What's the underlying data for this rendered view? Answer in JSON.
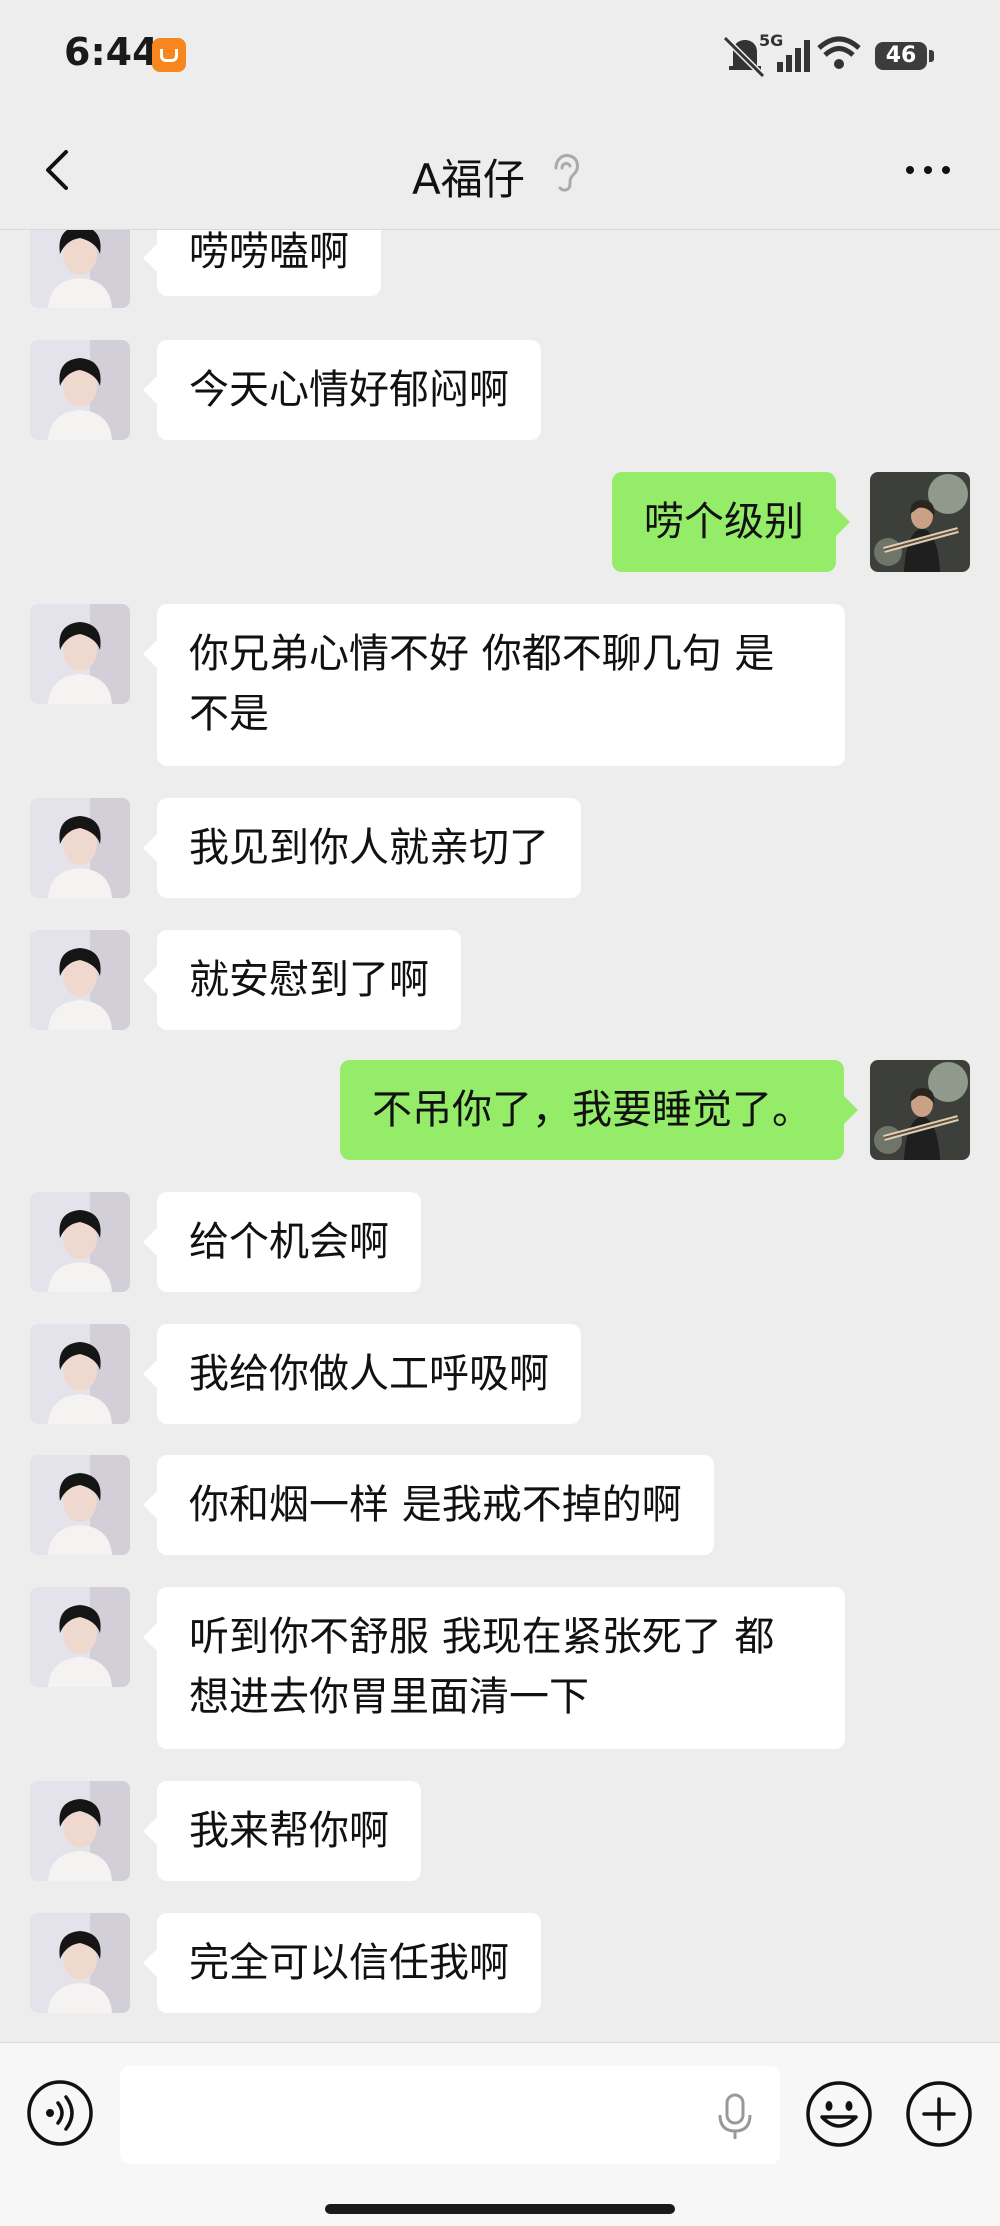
{
  "status_bar": {
    "time": "6:44",
    "battery": "46",
    "network": "5G",
    "icons": [
      "muted-bell-icon",
      "signal-icon",
      "wifi-icon",
      "battery-icon"
    ]
  },
  "nav": {
    "title": "A福仔",
    "icons": [
      "back-arrow-icon",
      "ear-icon",
      "more-icon"
    ]
  },
  "messages": [
    {
      "side": "left",
      "text": "唠唠嗑啊"
    },
    {
      "side": "left",
      "text": "今天心情好郁闷啊"
    },
    {
      "side": "right",
      "text": "唠个级别"
    },
    {
      "side": "left",
      "text": "你兄弟心情不好 你都不聊几句 是\n不是"
    },
    {
      "side": "left",
      "text": "我见到你人就亲切了"
    },
    {
      "side": "left",
      "text": "就安慰到了啊"
    },
    {
      "side": "right",
      "text": "不吊你了，我要睡觉了。"
    },
    {
      "side": "left",
      "text": "给个机会啊"
    },
    {
      "side": "left",
      "text": "我给你做人工呼吸啊"
    },
    {
      "side": "left",
      "text": "你和烟一样 是我戒不掉的啊"
    },
    {
      "side": "left",
      "text": "听到你不舒服 我现在紧张死了 都\n想进去你胃里面清一下"
    },
    {
      "side": "left",
      "text": "我来帮你啊"
    },
    {
      "side": "left",
      "text": "完全可以信任我啊"
    }
  ],
  "input_bar": {
    "placeholder": "",
    "icons": [
      "voice-icon",
      "mic-icon",
      "emoji-icon",
      "plus-icon"
    ]
  },
  "colors": {
    "background": "#ededed",
    "sent_bubble": "#95ec69",
    "received_bubble": "#ffffff"
  }
}
